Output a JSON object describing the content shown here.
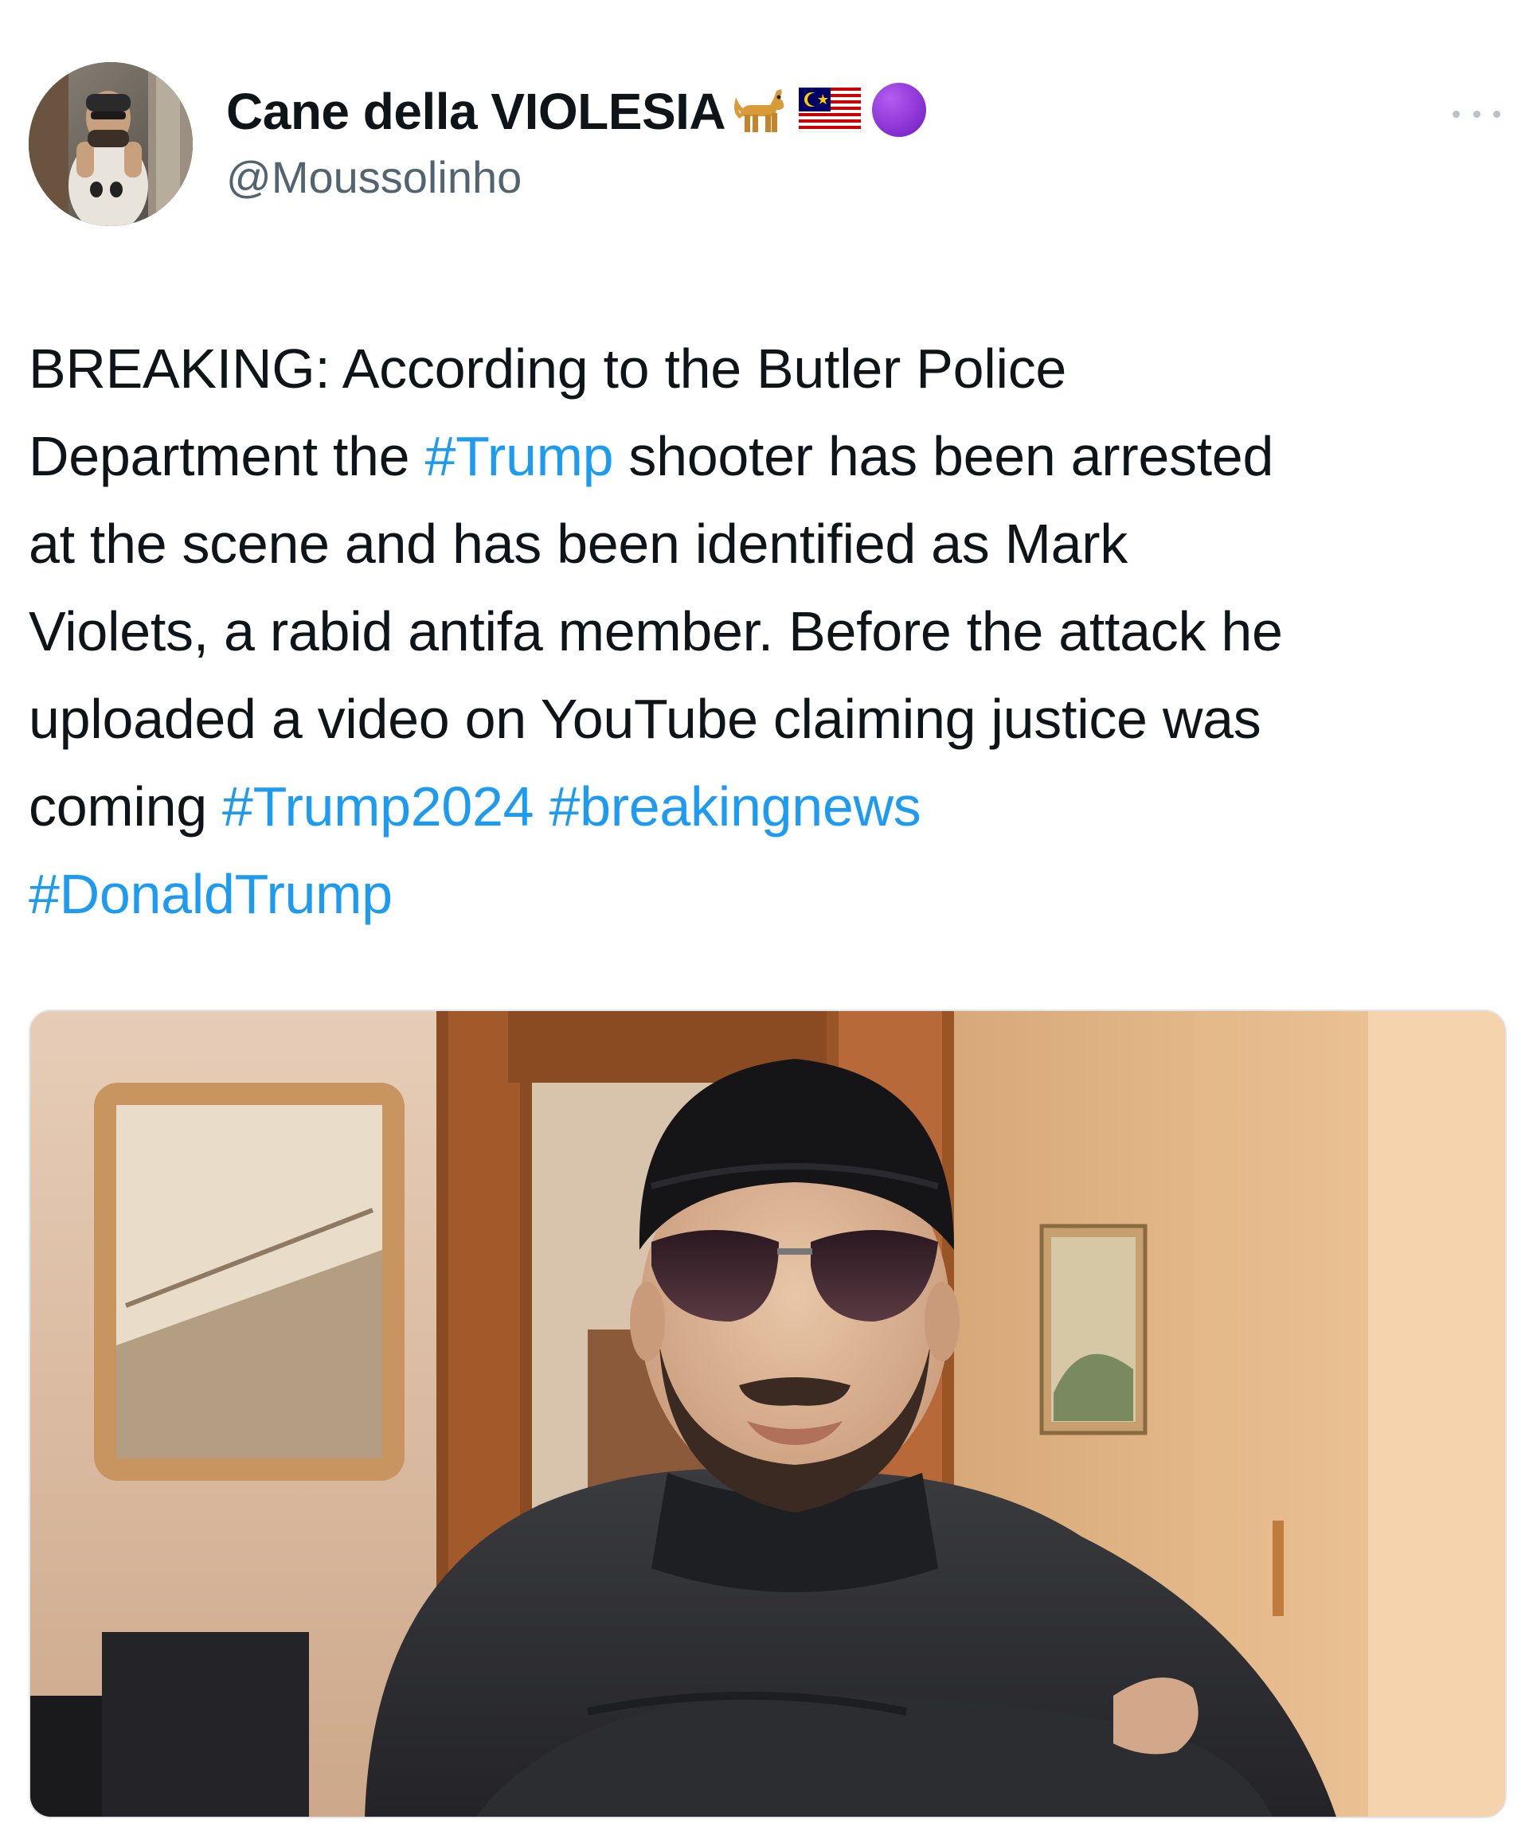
{
  "author": {
    "display_name": "Cane della VIOLESIA",
    "handle": "@Moussolinho",
    "badges": [
      "dog-emoji",
      "malaysia-flag-emoji",
      "purple-circle-emoji"
    ],
    "avatar": "profile-photo"
  },
  "menu": {
    "icon": "more-horizontal-icon"
  },
  "tweet": {
    "lines": [
      [
        {
          "text": "BREAKING: According to the Butler Police",
          "hashtag": false
        }
      ],
      [
        {
          "text": "Department the ",
          "hashtag": false
        },
        {
          "text": "#Trump",
          "hashtag": true
        },
        {
          "text": " shooter has been arrested",
          "hashtag": false
        }
      ],
      [
        {
          "text": "at the scene and has been identified as Mark",
          "hashtag": false
        }
      ],
      [
        {
          "text": "Violets, a rabid antifa member. Before the attack he",
          "hashtag": false
        }
      ],
      [
        {
          "text": "uploaded a video on YouTube claiming justice was",
          "hashtag": false
        }
      ],
      [
        {
          "text": "coming ",
          "hashtag": false
        },
        {
          "text": "#Trump2024",
          "hashtag": true
        },
        {
          "text": " ",
          "hashtag": false
        },
        {
          "text": "#breakingnews",
          "hashtag": true
        }
      ],
      [
        {
          "text": "#DonaldTrump",
          "hashtag": true
        }
      ]
    ]
  },
  "media": {
    "type": "photo",
    "subject": "man-in-beanie-and-sunglasses-photo"
  },
  "colors": {
    "hashtag": "#1d9bf0",
    "text": "#0f1419",
    "secondary_text": "#536471"
  }
}
